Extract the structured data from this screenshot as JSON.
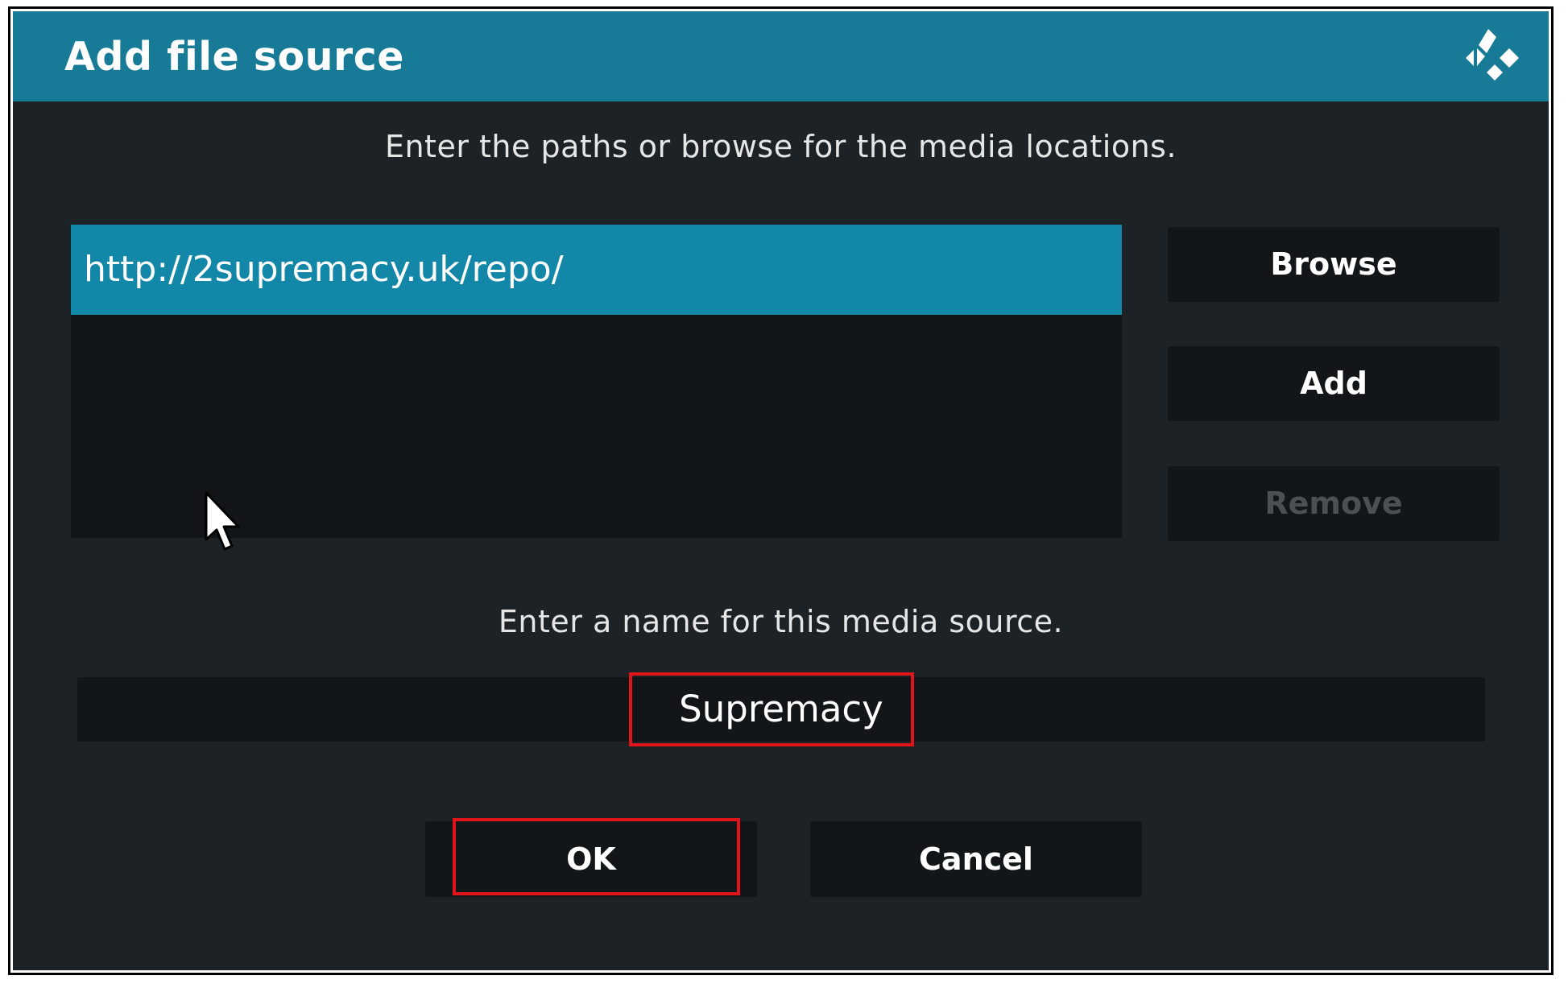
{
  "dialog": {
    "title": "Add file source",
    "paths_instruction": "Enter the paths or browse for the media locations.",
    "paths": [
      {
        "value": "http://2supremacy.uk/repo/",
        "selected": true
      }
    ],
    "side_buttons": {
      "browse": "Browse",
      "add": "Add",
      "remove": "Remove"
    },
    "name_instruction": "Enter a name for this media source.",
    "name_value": "Supremacy",
    "buttons": {
      "ok": "OK",
      "cancel": "Cancel"
    }
  },
  "icons": {
    "logo": "kodi-logo-icon",
    "cursor": "mouse-pointer-icon"
  },
  "colors": {
    "titlebar": "#177b97",
    "selected_item": "#1287a8",
    "dialog_bg": "#1c2226",
    "field_bg": "#131618",
    "highlight": "#e0151b"
  }
}
